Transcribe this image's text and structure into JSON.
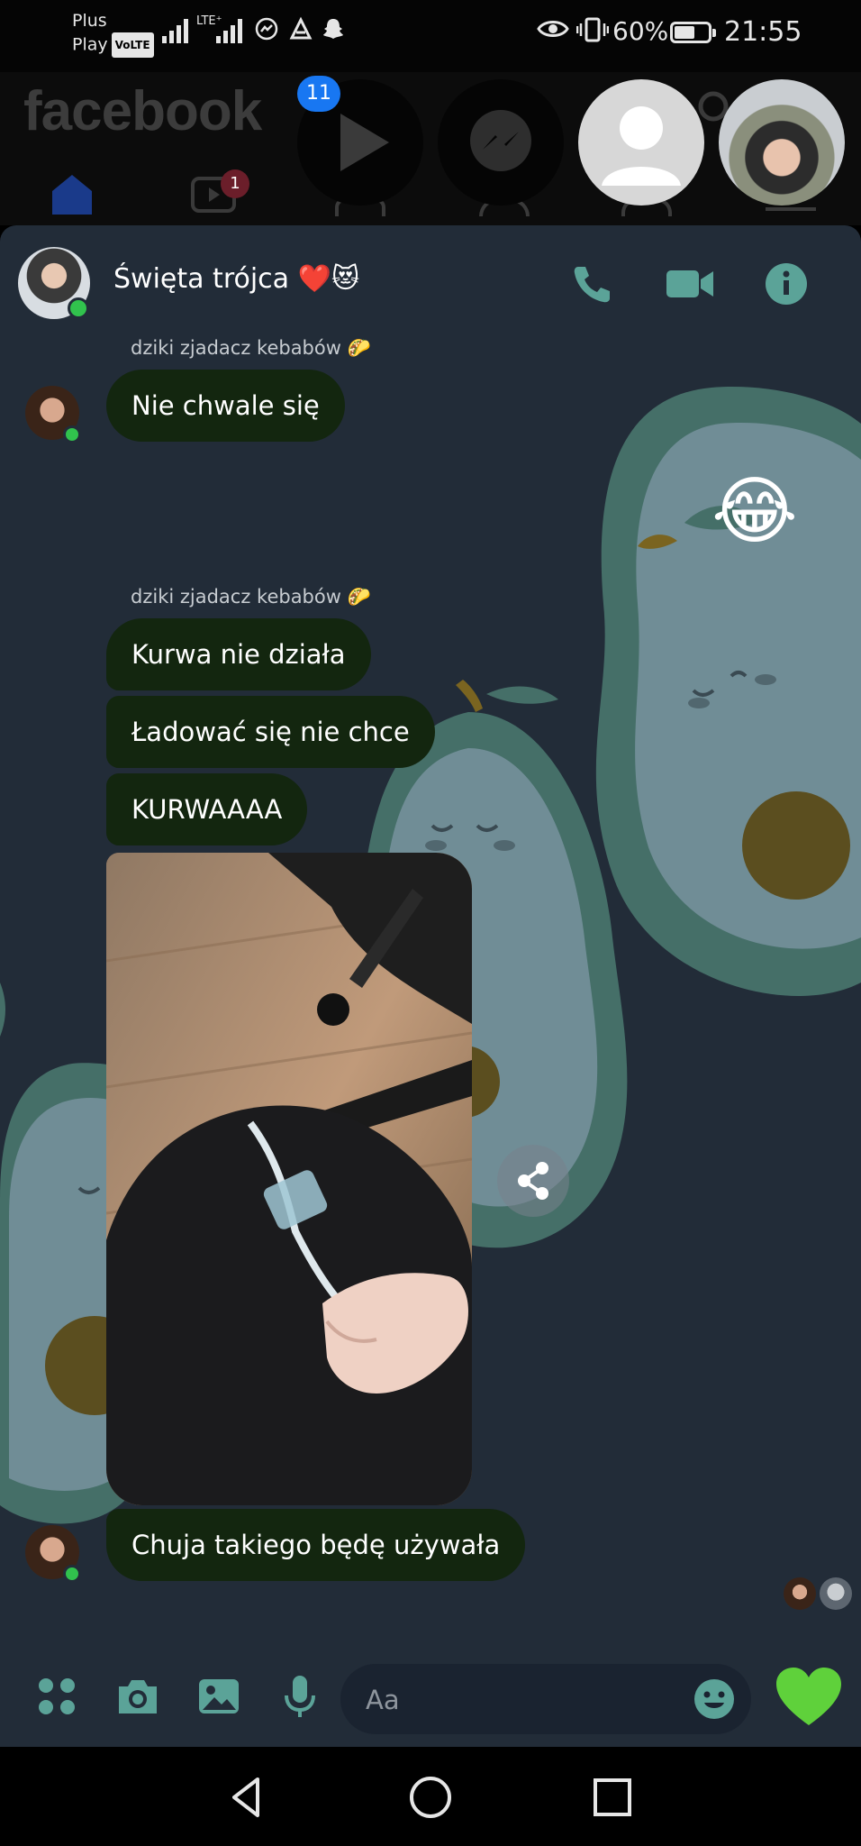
{
  "status_bar": {
    "carrier_line1": "Plus",
    "carrier_line2": "Play",
    "volte": "VoLTE",
    "lte": "LTE⁺",
    "battery_percent": "60%",
    "battery_level": 0.6,
    "time": "21:55"
  },
  "facebook": {
    "logo": "facebook",
    "video_badge": "1",
    "chat_head_badge": "11"
  },
  "chat": {
    "title": "Święta trójca ❤️😻",
    "messages": {
      "group1_sender": "dziki zjadacz kebabów 🌮",
      "group1_text": "Nie chwale się",
      "reaction_emoji": "😂",
      "group2_sender": "dziki zjadacz kebabów 🌮",
      "group2_msg1": "Kurwa nie działa",
      "group2_msg2": "Ładować się nie chce",
      "group2_msg3": "KURWAAAA",
      "group2_msg4": "Chuja takiego będę używała"
    }
  },
  "composer": {
    "placeholder": "Aa"
  },
  "colors": {
    "accent": "#5ba398",
    "bubble": "#13260f",
    "chat_bg": "#222c38",
    "heart": "#5fd13b"
  }
}
